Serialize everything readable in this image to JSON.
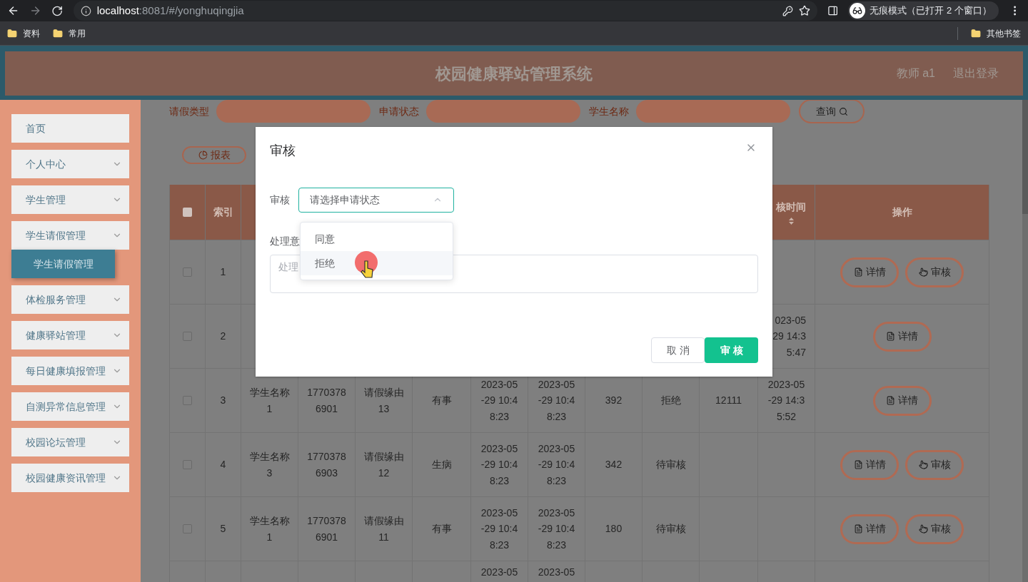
{
  "browser": {
    "url_host": "localhost",
    "url_path": ":8081/#/yonghuqingjia",
    "profile": "无痕模式（已打开 2 个窗口）",
    "bookmarks": [
      "资料",
      "常用"
    ],
    "other_bookmarks": "其他书签"
  },
  "header": {
    "title": "校园健康驿站管理系统",
    "user": "教师 a1",
    "logout": "退出登录"
  },
  "sidebar": {
    "items": [
      {
        "label": "首页",
        "kind": "link"
      },
      {
        "label": "个人中心",
        "kind": "menu"
      },
      {
        "label": "学生管理",
        "kind": "menu"
      },
      {
        "label": "学生请假管理",
        "kind": "menu",
        "children": [
          {
            "label": "学生请假管理",
            "selected": true
          }
        ]
      },
      {
        "label": "体检服务管理",
        "kind": "menu"
      },
      {
        "label": "健康驿站管理",
        "kind": "menu"
      },
      {
        "label": "每日健康填报管理",
        "kind": "menu"
      },
      {
        "label": "自测异常信息管理",
        "kind": "menu"
      },
      {
        "label": "校园论坛管理",
        "kind": "menu"
      },
      {
        "label": "校园健康资讯管理",
        "kind": "menu"
      }
    ]
  },
  "filters": [
    {
      "label": "请假类型"
    },
    {
      "label": "申请状态"
    },
    {
      "label": "学生名称"
    }
  ],
  "search_button": "查询",
  "report_button": "报表",
  "table": {
    "select_all_checked": false,
    "columns": {
      "index": "索引",
      "audit_time": "核时间",
      "actions": "操作"
    },
    "rows": [
      {
        "checked": false,
        "index": "1",
        "actions": [
          {
            "kind": "detail",
            "label": "详情"
          },
          {
            "kind": "audit",
            "label": "审核"
          }
        ]
      },
      {
        "checked": false,
        "index": "2",
        "audit_time": [
          "023-05",
          "29 14:3",
          "5:47"
        ],
        "actions": [
          {
            "kind": "detail",
            "label": "详情"
          }
        ]
      },
      {
        "checked": false,
        "index": "3",
        "name": "学生名称1",
        "phone": "17703786901",
        "reason": "请假缘由13",
        "type": "有事",
        "start": "2023-05-29 10:48:23",
        "end": "2023-05-29 10:48:23",
        "days": "392",
        "status": "拒绝",
        "opinion": "12111",
        "audit_time": "2023-05-29 14:35:52",
        "actions": [
          {
            "kind": "detail",
            "label": "详情"
          }
        ]
      },
      {
        "checked": false,
        "index": "4",
        "name": "学生名称3",
        "phone": "17703786903",
        "reason": "请假缘由12",
        "type": "生病",
        "start": "2023-05-29 10:48:23",
        "end": "2023-05-29 10:48:23",
        "days": "342",
        "status": "待审核",
        "actions": [
          {
            "kind": "detail",
            "label": "详情"
          },
          {
            "kind": "audit",
            "label": "审核"
          }
        ]
      },
      {
        "checked": false,
        "index": "5",
        "name": "学生名称1",
        "phone": "17703786901",
        "reason": "请假缘由11",
        "type": "有事",
        "start": "2023-05-29 10:48:23",
        "end": "2023-05-29 10:48:23",
        "days": "180",
        "status": "待审核",
        "actions": [
          {
            "kind": "detail",
            "label": "详情"
          },
          {
            "kind": "audit",
            "label": "审核"
          }
        ]
      },
      {
        "start": "2023-05",
        "end": "2023-05"
      }
    ]
  },
  "dialog": {
    "title": "审核",
    "field_label": "审核",
    "select": {
      "placeholder": "请选择申请状态",
      "open": true,
      "options": [
        {
          "label": "同意",
          "highlighted": false
        },
        {
          "label": "拒绝",
          "highlighted": true
        }
      ]
    },
    "opinion_label": "处理意",
    "opinion_placeholder": "处理",
    "cancel": "取消",
    "confirm": "审核"
  }
}
